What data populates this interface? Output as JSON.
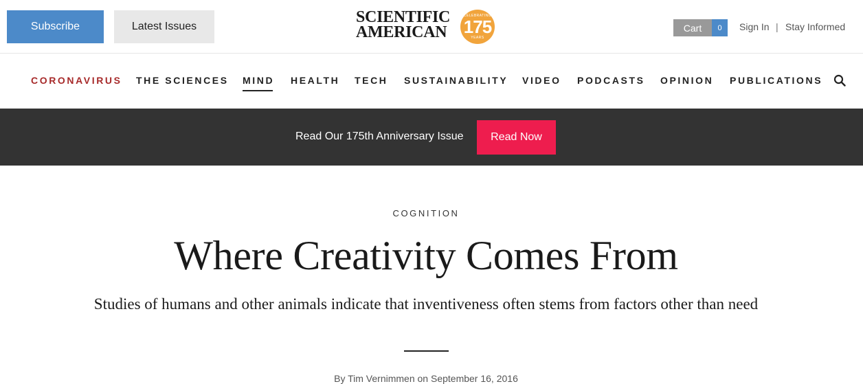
{
  "header": {
    "subscribe_label": "Subscribe",
    "latest_issues_label": "Latest Issues",
    "logo": {
      "line1": "SCIENTIFIC",
      "line2": "AMERICAN",
      "badge_number": "175",
      "badge_top": "CELEBRATING",
      "badge_bottom": "YEARS"
    },
    "cart_label": "Cart",
    "cart_count": "0",
    "sign_in_label": "Sign In",
    "separator": "|",
    "stay_informed_label": "Stay Informed"
  },
  "nav": {
    "items": [
      {
        "label": "CORONAVIRUS"
      },
      {
        "label": "THE SCIENCES"
      },
      {
        "label": "MIND"
      },
      {
        "label": "HEALTH"
      },
      {
        "label": "TECH"
      },
      {
        "label": "SUSTAINABILITY"
      },
      {
        "label": "VIDEO"
      },
      {
        "label": "PODCASTS"
      },
      {
        "label": "OPINION"
      },
      {
        "label": "PUBLICATIONS"
      }
    ],
    "active": "MIND",
    "accent_item": "CORONAVIRUS",
    "search_icon": "search-icon"
  },
  "banner": {
    "text": "Read Our 175th Anniversary Issue",
    "button_label": "Read Now"
  },
  "article": {
    "kicker": "COGNITION",
    "headline": "Where Creativity Comes From",
    "dek": "Studies of humans and other animals indicate that inventiveness often stems from factors other than need",
    "byline_prefix": "By",
    "author": "Tim Vernimmen",
    "byline_on": "on",
    "date": "September 16, 2016"
  },
  "colors": {
    "subscribe_blue": "#4c8ac9",
    "coronavirus_red": "#a72a2a",
    "banner_dark": "#333333",
    "read_now_pink": "#ee1d4e",
    "logo_badge_orange": "#f1a43c"
  }
}
